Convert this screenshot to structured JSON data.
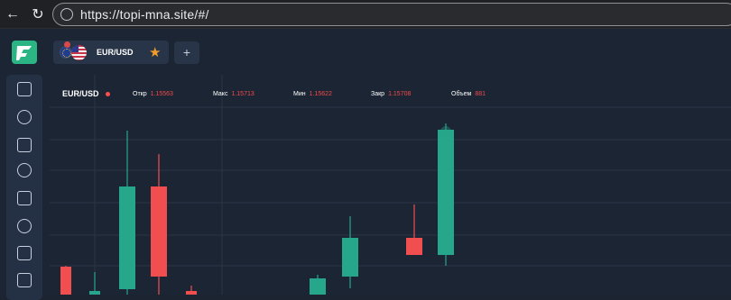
{
  "browser": {
    "url": "https://topi-mna.site/#/"
  },
  "tabs": {
    "pair": "EUR/USD",
    "add_label": "+"
  },
  "chart": {
    "symbol": "EUR/USD",
    "open_label": "Откр",
    "open_value": "1.15563",
    "max_label": "Макс",
    "max_value": "1.15713",
    "min_label": "Мин",
    "min_value": "1.15622",
    "close_label": "Закр",
    "close_value": "1.15708",
    "volume_label": "Объем",
    "volume_value": "881"
  },
  "colors": {
    "bullish": "#26a68a",
    "bearish": "#f04e4f",
    "brand": "#2bb585",
    "background": "#1c2534",
    "grid": "#2b3546"
  },
  "sidebar": {
    "icons": [
      "chart-icon",
      "speedometer-icon",
      "briefcase-icon",
      "clock-icon",
      "book-icon",
      "settings-icon",
      "contacts-icon",
      "calendar-icon"
    ]
  },
  "chart_data": {
    "type": "candlestick",
    "candles": [
      {
        "dir": "down",
        "open": 31,
        "close": 0,
        "high": 32,
        "low": 0
      },
      {
        "dir": "up",
        "open": 0,
        "close": 4,
        "high": 25,
        "low": 0
      },
      {
        "dir": "up",
        "open": 6,
        "close": 120,
        "high": 182,
        "low": 0
      },
      {
        "dir": "down",
        "open": 120,
        "close": 20,
        "high": 156,
        "low": 0
      },
      {
        "dir": "down",
        "open": 4,
        "close": 0,
        "high": 10,
        "low": 0
      },
      {
        "dir": "up",
        "open": 0,
        "close": 18,
        "high": 22,
        "low": 0
      },
      {
        "dir": "up",
        "open": 20,
        "close": 63,
        "high": 87,
        "low": 7
      },
      {
        "dir": "down",
        "open": 63,
        "close": 44,
        "high": 100,
        "low": 46
      },
      {
        "dir": "up",
        "open": 44,
        "close": 183,
        "high": 190,
        "low": 32
      }
    ]
  }
}
